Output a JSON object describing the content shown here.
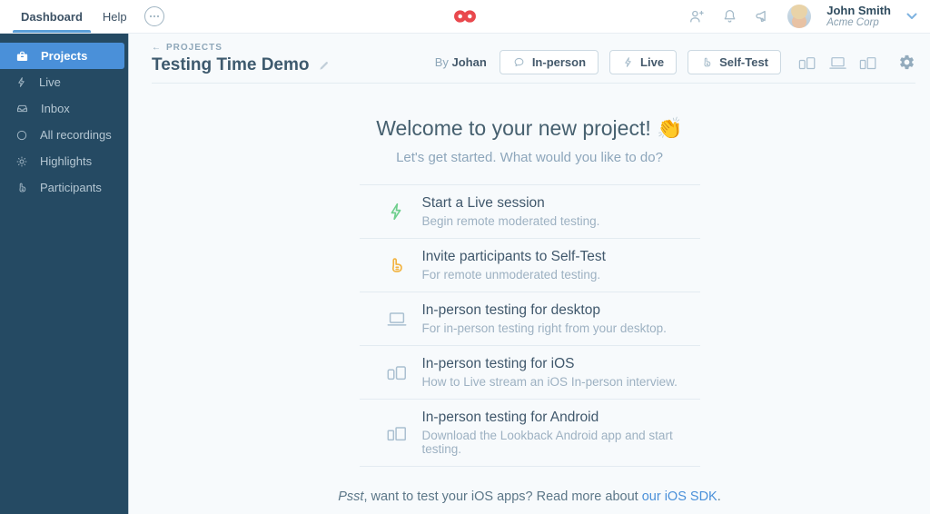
{
  "topbar": {
    "nav": [
      {
        "label": "Dashboard"
      },
      {
        "label": "Help"
      }
    ],
    "user": {
      "name": "John Smith",
      "org": "Acme Corp"
    }
  },
  "icons": {
    "more_menu": "ellipsis-circle",
    "invite": "person-plus",
    "notifications": "bell",
    "announcements": "megaphone",
    "settings": "gear",
    "edit": "pencil",
    "logo": "red-infinity"
  },
  "sidebar": {
    "items": [
      {
        "label": "Projects",
        "icon": "briefcase",
        "active": true
      },
      {
        "label": "Live",
        "icon": "lightning"
      },
      {
        "label": "Inbox",
        "icon": "inbox-tray"
      },
      {
        "label": "All recordings",
        "icon": "circle"
      },
      {
        "label": "Highlights",
        "icon": "sun"
      },
      {
        "label": "Participants",
        "icon": "hand"
      }
    ]
  },
  "header": {
    "breadcrumb_arrow": "←",
    "breadcrumb": "PROJECTS",
    "title": "Testing Time Demo",
    "byline_prefix": "By",
    "byline_name": "Johan",
    "buttons": [
      {
        "label": "In-person",
        "icon": "speech-bubble"
      },
      {
        "label": "Live",
        "icon": "lightning"
      },
      {
        "label": "Self-Test",
        "icon": "hand"
      }
    ]
  },
  "welcome": {
    "title": "Welcome to your new project!",
    "emoji": "👏",
    "subtitle": "Let's get started. What would you like to do?"
  },
  "actions": [
    {
      "icon": "lightning",
      "icon_color": "#70cf8e",
      "title": "Start a Live session",
      "subtitle": "Begin remote moderated testing."
    },
    {
      "icon": "hand",
      "icon_color": "#f2b340",
      "title": "Invite participants to Self-Test",
      "subtitle": "For remote unmoderated testing."
    },
    {
      "icon": "laptop",
      "icon_color": "#a9bfd0",
      "title": "In-person testing for desktop",
      "subtitle": "For in-person testing right from your desktop."
    },
    {
      "icon": "phone-tablet-ios",
      "icon_color": "#a9bfd0",
      "title": "In-person testing for iOS",
      "subtitle": "How to Live stream an iOS In-person interview."
    },
    {
      "icon": "phone-tablet-android",
      "icon_color": "#a9bfd0",
      "title": "In-person testing for Android",
      "subtitle": "Download the Lookback Android app and start testing."
    }
  ],
  "footer": {
    "psst": "Psst",
    "middle": ", want to test your iOS apps? Read more about ",
    "link": "our iOS SDK",
    "end": "."
  },
  "colors": {
    "accent_blue": "#4a90d9",
    "brand_red": "#e9484d",
    "green": "#70cf8e",
    "orange": "#f2b340",
    "sidebar_bg": "#254a63",
    "main_bg": "#f7fafc"
  }
}
